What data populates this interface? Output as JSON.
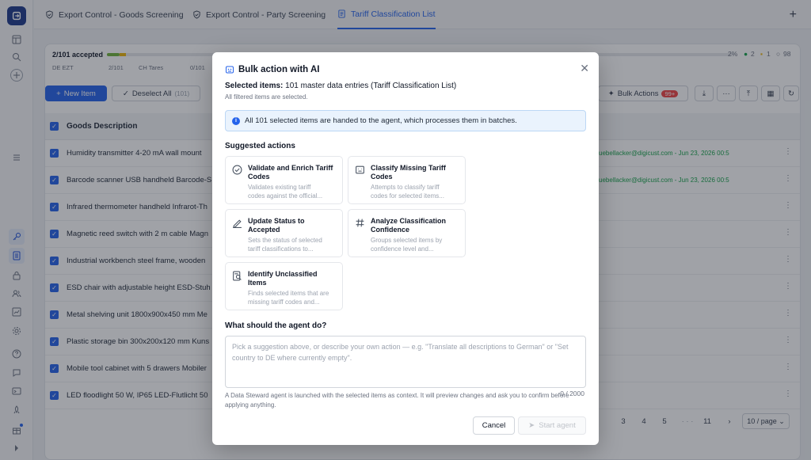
{
  "tabs": [
    {
      "label": "Export Control - Goods Screening",
      "icon": "shield-check-icon"
    },
    {
      "label": "Export Control - Party Screening",
      "icon": "shield-check-icon"
    },
    {
      "label": "Tariff Classification List",
      "icon": "document-icon",
      "active": true
    }
  ],
  "progress": {
    "title": "2/101 accepted",
    "fraction": 0.02,
    "percent": "2%",
    "accepted_count": "2",
    "warn_count": "1",
    "pending_count": "98",
    "subs": [
      {
        "label": "DE EZT",
        "value": "2/101"
      },
      {
        "label": "CH Tares",
        "value": "0/101"
      }
    ]
  },
  "toolbar": {
    "new_item": "New Item",
    "deselect_all": "Deselect All",
    "deselect_count": "(101)",
    "bulk_actions": "Bulk Actions",
    "bulk_badge": "99+"
  },
  "table": {
    "column": "Goods Description",
    "rows": [
      {
        "desc": "Humidity transmitter 4-20 mA wall mount",
        "status": "accepted - t.uebellacker@digicust.com - Jun 23, 2026 00:5"
      },
      {
        "desc": "Barcode scanner USB handheld Barcode-S",
        "status": "accepted - t.uebellacker@digicust.com - Jun 23, 2026 00:5"
      },
      {
        "desc": "Infrared thermometer handheld Infrarot-Th",
        "action": "Accept"
      },
      {
        "desc": "Magnetic reed switch with 2 m cable Magn"
      },
      {
        "desc": "Industrial workbench steel frame, wooden"
      },
      {
        "desc": "ESD chair with adjustable height ESD-Stuh"
      },
      {
        "desc": "Metal shelving unit 1800x900x450 mm Me"
      },
      {
        "desc": "Plastic storage bin 300x200x120 mm Kuns"
      },
      {
        "desc": "Mobile tool cabinet with 5 drawers Mobiler"
      },
      {
        "desc": "LED floodlight 50 W, IP65 LED-Flutlicht 50"
      }
    ]
  },
  "pager": {
    "pages": [
      "2",
      "3",
      "4",
      "5",
      "· · ·",
      "11"
    ],
    "next": "›",
    "per_page": "10 / page"
  },
  "modal": {
    "title": "Bulk action with AI",
    "selected_label": "Selected items:",
    "selected_value": "101 master data entries (Tariff Classification List)",
    "filtered_note": "All filtered items are selected.",
    "info": "All 101 selected items are handed to the agent, which processes them in batches.",
    "suggested_title": "Suggested actions",
    "suggestions": [
      {
        "title": "Validate and Enrich Tariff Codes",
        "desc1": "Validates existing tariff",
        "desc2": "codes against the official...",
        "icon": "check-circle-icon"
      },
      {
        "title": "Classify Missing Tariff Codes",
        "desc1": "Attempts to classify tariff",
        "desc2": "codes for selected items...",
        "icon": "robot-icon"
      },
      {
        "title": "Update Status to Accepted",
        "desc1": "Sets the status of selected",
        "desc2": "tariff classifications to...",
        "icon": "pencil-icon"
      },
      {
        "title": "Analyze Classification Confidence",
        "desc1": "Groups selected items by",
        "desc2": "confidence level and...",
        "icon": "hash-icon"
      },
      {
        "title": "Identify Unclassified Items",
        "desc1": "Finds selected items that are",
        "desc2": "missing tariff codes and...",
        "icon": "document-search-icon"
      }
    ],
    "agent_question": "What should the agent do?",
    "placeholder": "Pick a suggestion above, or describe your own action — e.g. \"Translate all descriptions to German\" or \"Set country to DE where currently empty\".",
    "char_count": "0 / 2000",
    "footnote": "A Data Steward agent is launched with the selected items as context. It will preview changes and ask you to confirm before applying anything.",
    "cancel": "Cancel",
    "start": "Start agent"
  }
}
